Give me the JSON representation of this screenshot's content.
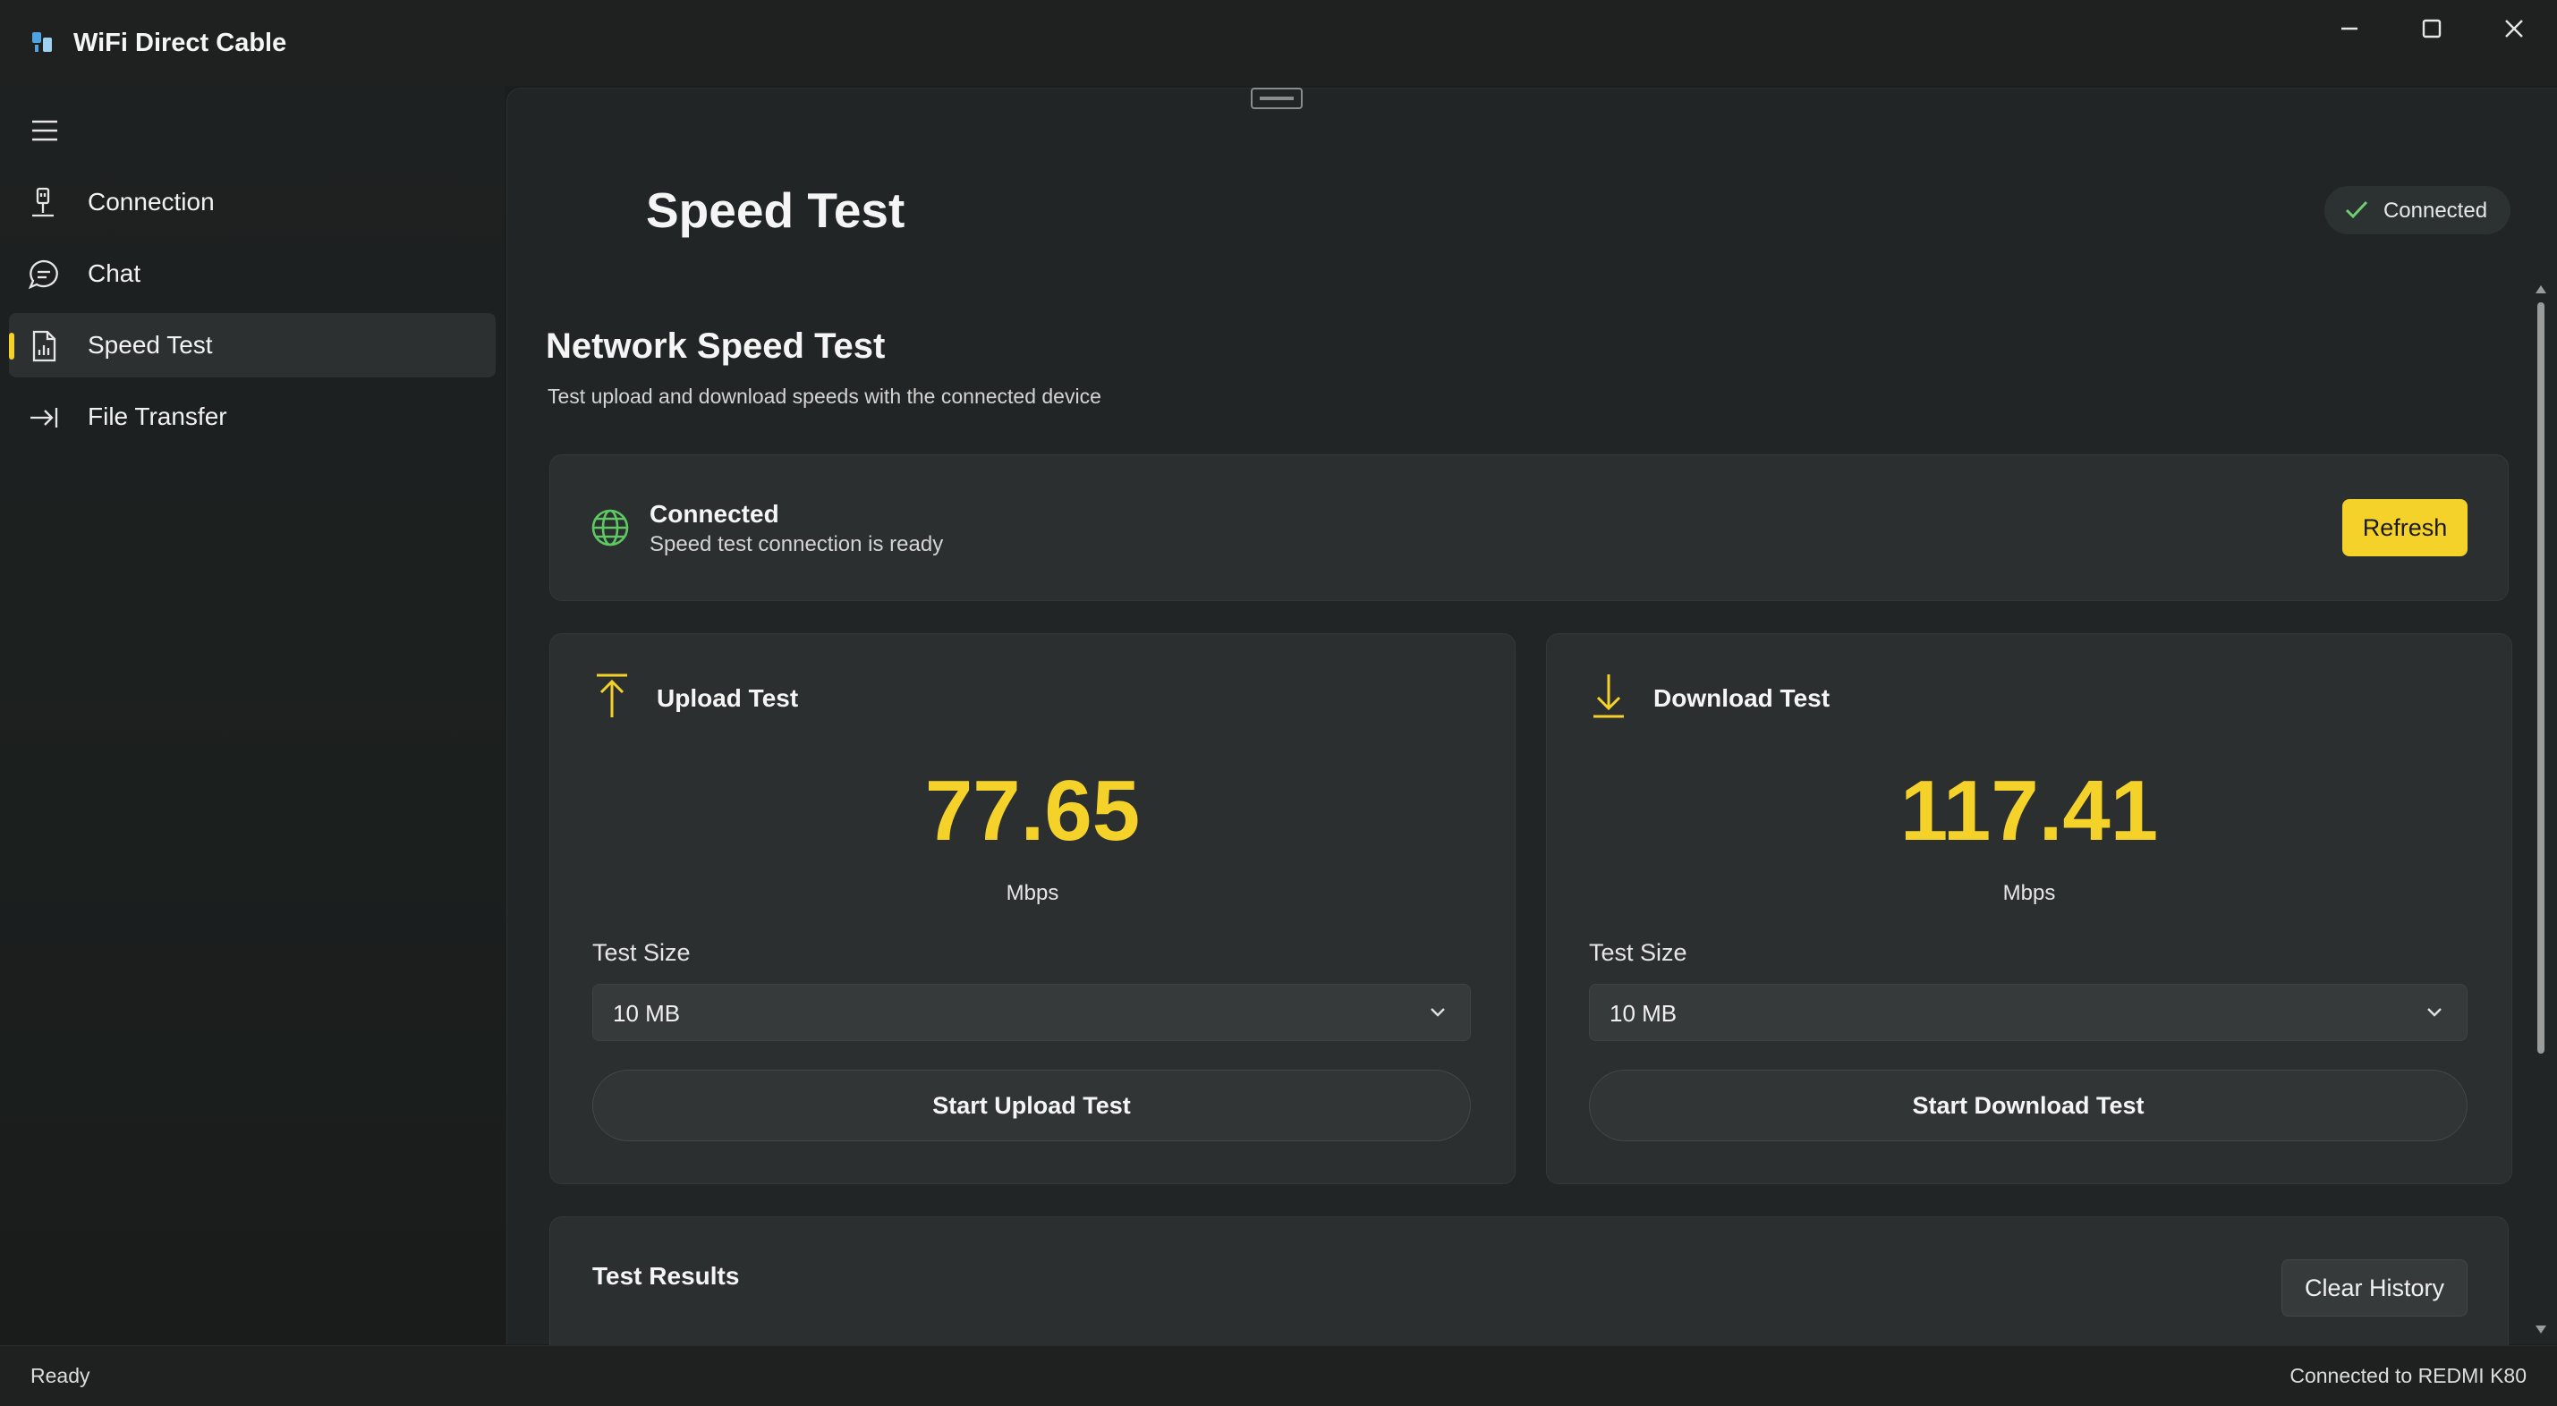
{
  "window": {
    "title": "WiFi Direct Cable",
    "icons": {
      "app": "cable-app-icon",
      "minimize": "minimize-icon",
      "maximize": "maximize-icon",
      "close": "close-icon"
    }
  },
  "sidebar": {
    "menu_icon": "hamburger-icon",
    "items": [
      {
        "label": "Connection",
        "icon": "usb-plug-icon",
        "active": false
      },
      {
        "label": "Chat",
        "icon": "chat-bubble-icon",
        "active": false
      },
      {
        "label": "Speed Test",
        "icon": "chart-document-icon",
        "active": true
      },
      {
        "label": "File Transfer",
        "icon": "arrow-to-line-icon",
        "active": false
      }
    ]
  },
  "header": {
    "page_title": "Speed Test",
    "status_badge": "Connected"
  },
  "main": {
    "section_title": "Network Speed Test",
    "section_subtitle": "Test upload and download speeds with the connected device",
    "connection_card": {
      "title": "Connected",
      "subtitle": "Speed test connection is ready",
      "refresh_label": "Refresh"
    },
    "upload": {
      "title": "Upload Test",
      "value": "77.65",
      "unit": "Mbps",
      "size_label": "Test Size",
      "size_value": "10 MB",
      "button_label": "Start Upload Test"
    },
    "download": {
      "title": "Download Test",
      "value": "117.41",
      "unit": "Mbps",
      "size_label": "Test Size",
      "size_value": "10 MB",
      "button_label": "Start Download Test"
    },
    "results": {
      "title": "Test Results",
      "clear_label": "Clear History"
    }
  },
  "statusbar": {
    "left": "Ready",
    "right": "Connected to REDMI K80"
  },
  "colors": {
    "accent": "#f5d22a",
    "success": "#5ec862",
    "background": "#222525",
    "sidebar": "#1e2121"
  }
}
